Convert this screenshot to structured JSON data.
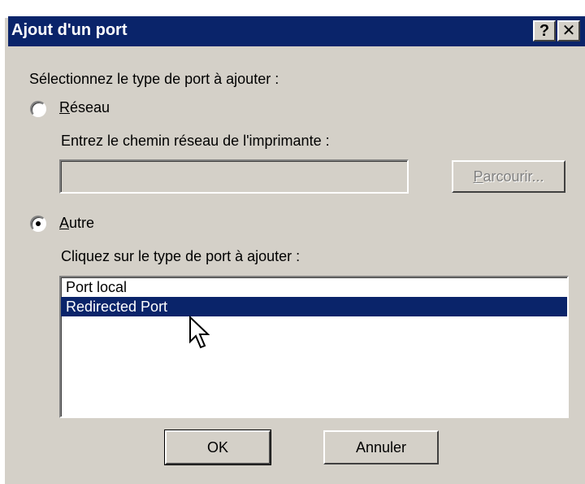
{
  "window": {
    "title": "Ajout d'un port",
    "help_label": "?",
    "close_label": "✕"
  },
  "prompt": "Sélectionnez le type de port à ajouter :",
  "network": {
    "label_first": "R",
    "label_rest": "éseau",
    "selected": false,
    "path_label": "Entrez le chemin réseau de l'imprimante :",
    "path_value": "",
    "browse_first": "P",
    "browse_rest": "arcourir...",
    "browse_enabled": false
  },
  "other": {
    "label_first": "A",
    "label_rest": "utre",
    "selected": true,
    "list_label": "Cliquez sur le type de port à ajouter :",
    "items": [
      {
        "label": "Port local",
        "selected": false
      },
      {
        "label": "Redirected Port",
        "selected": true
      }
    ]
  },
  "buttons": {
    "ok_label": "OK",
    "cancel_label": "Annuler"
  },
  "colors": {
    "titlebar": "#0a246a",
    "face": "#d4d0c8",
    "selection": "#0a246a"
  }
}
